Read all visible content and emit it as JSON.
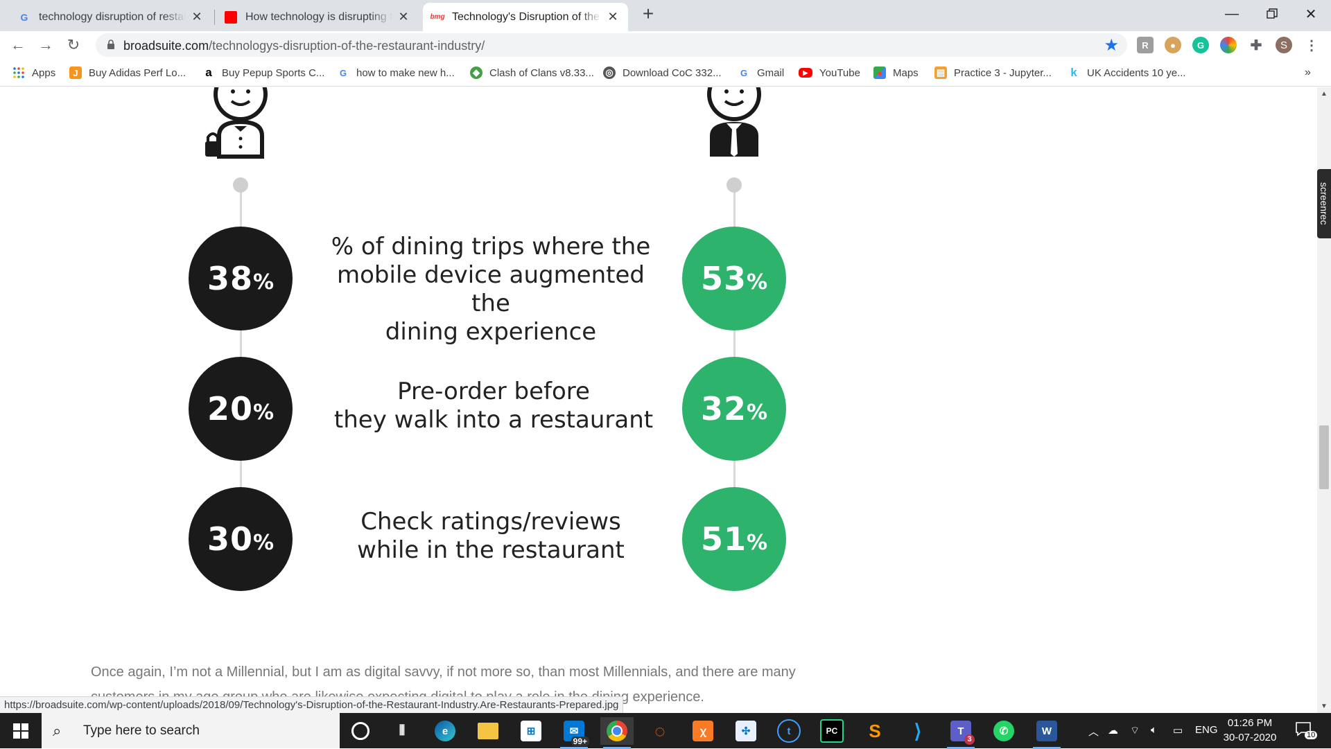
{
  "browser": {
    "tabs": [
      {
        "favicon": "G",
        "title": "technology disruption of restaurant",
        "active": false
      },
      {
        "favicon": "red-square",
        "title": "How technology is disrupting the",
        "active": false
      },
      {
        "favicon": "bmg",
        "title": "Technology's Disruption of the Restaurant Industry",
        "active": true
      }
    ],
    "url_host": "broadsuite.com",
    "url_path": "/technologys-disruption-of-the-restaurant-industry/",
    "profile_initial": "S",
    "bookmarks": [
      {
        "label": "Apps",
        "icon": "apps-grid-icon"
      },
      {
        "label": "Buy Adidas Perf Lo...",
        "icon": "J"
      },
      {
        "label": "Buy Pepup Sports C...",
        "icon": "a"
      },
      {
        "label": "how to make new h...",
        "icon": "G"
      },
      {
        "label": "Clash of Clans v8.33...",
        "icon": "clash-icon"
      },
      {
        "label": "Download CoC 332...",
        "icon": "globe-icon"
      },
      {
        "label": "Gmail",
        "icon": "G"
      },
      {
        "label": "YouTube",
        "icon": "youtube-icon"
      },
      {
        "label": "Maps",
        "icon": "maps-icon"
      },
      {
        "label": "Practice 3 - Jupyter...",
        "icon": "jupyter-icon"
      },
      {
        "label": "UK Accidents 10 ye...",
        "icon": "k"
      }
    ],
    "status_url": "https://broadsuite.com/wp-content/uploads/2018/09/Technology's-Disruption-of-the-Restaurant-Industry.Are-Restaurants-Prepared.jpg"
  },
  "infographic": {
    "rows": [
      {
        "left_num": "38",
        "right_num": "53",
        "pct": "%",
        "label_lines": [
          "% of dining trips where the",
          "mobile device augmented the",
          "dining experience"
        ]
      },
      {
        "left_num": "20",
        "right_num": "32",
        "pct": "%",
        "label_lines": [
          "Pre-order before",
          "they walk into a restaurant"
        ]
      },
      {
        "left_num": "30",
        "right_num": "51",
        "pct": "%",
        "label_lines": [
          "Check ratings/reviews",
          "while in the restaurant"
        ]
      }
    ],
    "colors": {
      "left": "#1a1a1a",
      "right": "#2db36b"
    }
  },
  "article": {
    "paragraph_line1": "Once again, I’m not a Millennial, but I am as digital savvy, if not more so, than most Millennials, and there are many",
    "paragraph_line2": "customers in my age group who are likewise expecting digital to play a role in the dining experience."
  },
  "screenrec_label": "screenrec",
  "taskbar": {
    "search_placeholder": "Type here to search",
    "mail_badge": "99+",
    "teams_badge": "3",
    "language": "ENG",
    "time": "01:26 PM",
    "date": "30-07-2020",
    "notification_count": "10"
  }
}
